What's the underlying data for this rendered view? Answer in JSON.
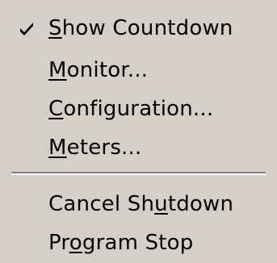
{
  "menu": {
    "items": [
      {
        "label": "Show Countdown",
        "checked": true,
        "mnemonic": "S"
      },
      {
        "label": "Monitor...",
        "checked": false,
        "mnemonic": "M"
      },
      {
        "label": "Configuration...",
        "checked": false,
        "mnemonic": "C"
      },
      {
        "label": "Meters...",
        "checked": false,
        "mnemonic": "M"
      }
    ],
    "items2": [
      {
        "label": "Cancel Shutdown",
        "mnemonic": "u"
      },
      {
        "label": "Program Stop",
        "mnemonic": "o"
      }
    ]
  },
  "icons": {
    "check": "checkmark-icon"
  },
  "colors": {
    "menu_bg": "#d4d0c8",
    "separator_dark": "#808080",
    "separator_light": "#ffffff",
    "text": "#000000"
  }
}
